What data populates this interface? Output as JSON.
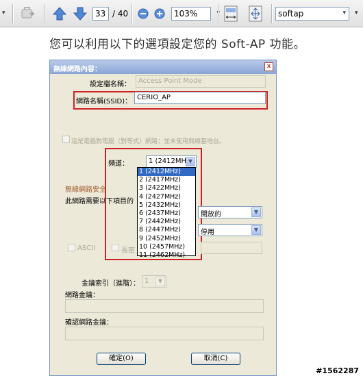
{
  "toolbar": {
    "page_current": "33",
    "page_total": "/ 40",
    "zoom": "103%",
    "search": "softap"
  },
  "document": {
    "intro_text": "您可以利用以下的選項設定您的 Soft-AP 功能。"
  },
  "dialog": {
    "title": "無線網路內容：",
    "close_label": "x",
    "setting_name_label": "設定檔名稱：",
    "setting_name_value": "Access Point Mode",
    "ssid_label": "網路名稱(SSID)：",
    "ssid_value": "CERIO_AP",
    "adhoc_checkbox_label": "這是電腦對電腦（對等式）網路；並未使用無線基地台。",
    "channel_label": "頻道：",
    "channel_selected": "1 (2412MHz)",
    "channel_options": [
      "1 (2412MHz)",
      "2 (2417MHz)",
      "3 (2422MHz)",
      "4 (2427MHz)",
      "5 (2432MHz)",
      "6 (2437MHz)",
      "7 (2442MHz)",
      "8 (2447MHz)",
      "9 (2452MHz)",
      "10 (2457MHz)",
      "11 (2462MHz)"
    ],
    "security_group_title": "無線網路安全",
    "security_desc": "此網路需要以下項目的",
    "auth_value": "開放的",
    "encryption_value": "停用",
    "ascii_label": "ASCII",
    "long_label": "長密",
    "key_index_label": "金鑰索引（進階）：",
    "key_index_value": "1",
    "network_key_label": "網路金鑰：",
    "confirm_key_label": "確認網路金鑰：",
    "ok_button": "確定(O)",
    "cancel_button": "取消(C)"
  },
  "watermark": "#1562287"
}
